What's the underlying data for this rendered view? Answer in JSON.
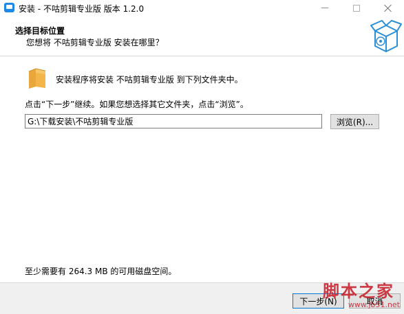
{
  "window": {
    "title": "安装 - 不咕剪辑专业版 版本 1.2.0"
  },
  "header": {
    "title": "选择目标位置",
    "subtitle": "您想将 不咕剪辑专业版 安装在哪里？"
  },
  "body": {
    "info": "安装程序将安装 不咕剪辑专业版 到下列文件夹中。",
    "instruction": "点击“下一步”继续。如果您想选择其它文件夹，点击“浏览”。",
    "path_value": "G:\\下载安装\\不咕剪辑专业版",
    "browse_label": "浏览(R)...",
    "space_required": "至少需要有 264.3 MB 的可用磁盘空间。"
  },
  "footer": {
    "next_label": "下一步(N)",
    "cancel_label": "取消"
  },
  "watermark": {
    "title": "脚本之家",
    "url": "www.jb51.net"
  },
  "colors": {
    "accent": "#0078d7",
    "folder": "#f3b54a",
    "watermark": "#c8202b",
    "footer_bg": "#f0f0f0"
  },
  "icons": [
    "app-icon",
    "minimize-icon",
    "maximize-icon",
    "close-icon",
    "install-box-icon",
    "folder-icon"
  ]
}
